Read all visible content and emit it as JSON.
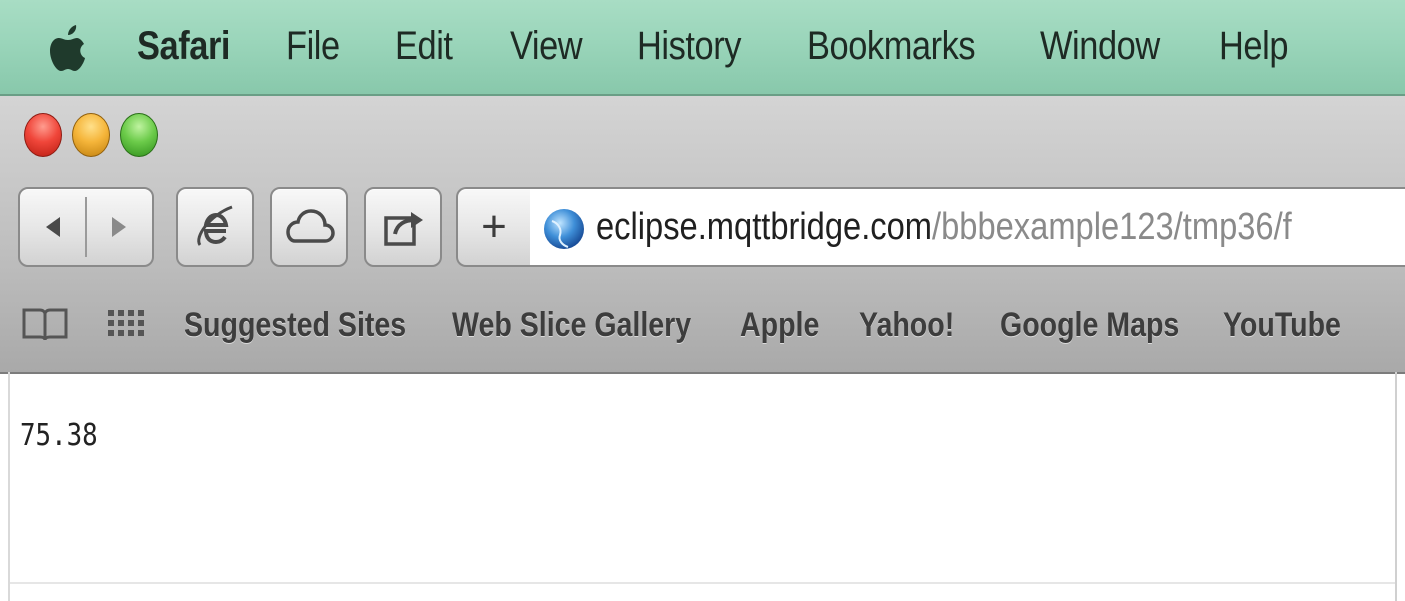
{
  "menubar": {
    "app_name": "Safari",
    "items": [
      "File",
      "Edit",
      "View",
      "History",
      "Bookmarks",
      "Window",
      "Help"
    ]
  },
  "window": {
    "traffic_lights": [
      "close",
      "minimize",
      "zoom"
    ]
  },
  "toolbar": {
    "back_icon": "back-arrow-icon",
    "forward_icon": "forward-arrow-icon",
    "ie_icon": "internet-explorer-icon",
    "cloud_icon": "cloud-icon",
    "share_icon": "share-icon",
    "add_label": "+",
    "url_host": "eclipse.mqttbridge.com",
    "url_path": "/bbbexample123/tmp36/f"
  },
  "bookmarks": {
    "items": [
      "Suggested Sites",
      "Web Slice Gallery",
      "Apple",
      "Yahoo!",
      "Google Maps",
      "YouTube"
    ]
  },
  "page": {
    "value": "75.38"
  },
  "colors": {
    "menubar": "#9ad5ba",
    "toolbar": "#bfbfbf",
    "close": "#f0463a",
    "minimize": "#f5b53a",
    "zoom": "#6ccb4a"
  }
}
